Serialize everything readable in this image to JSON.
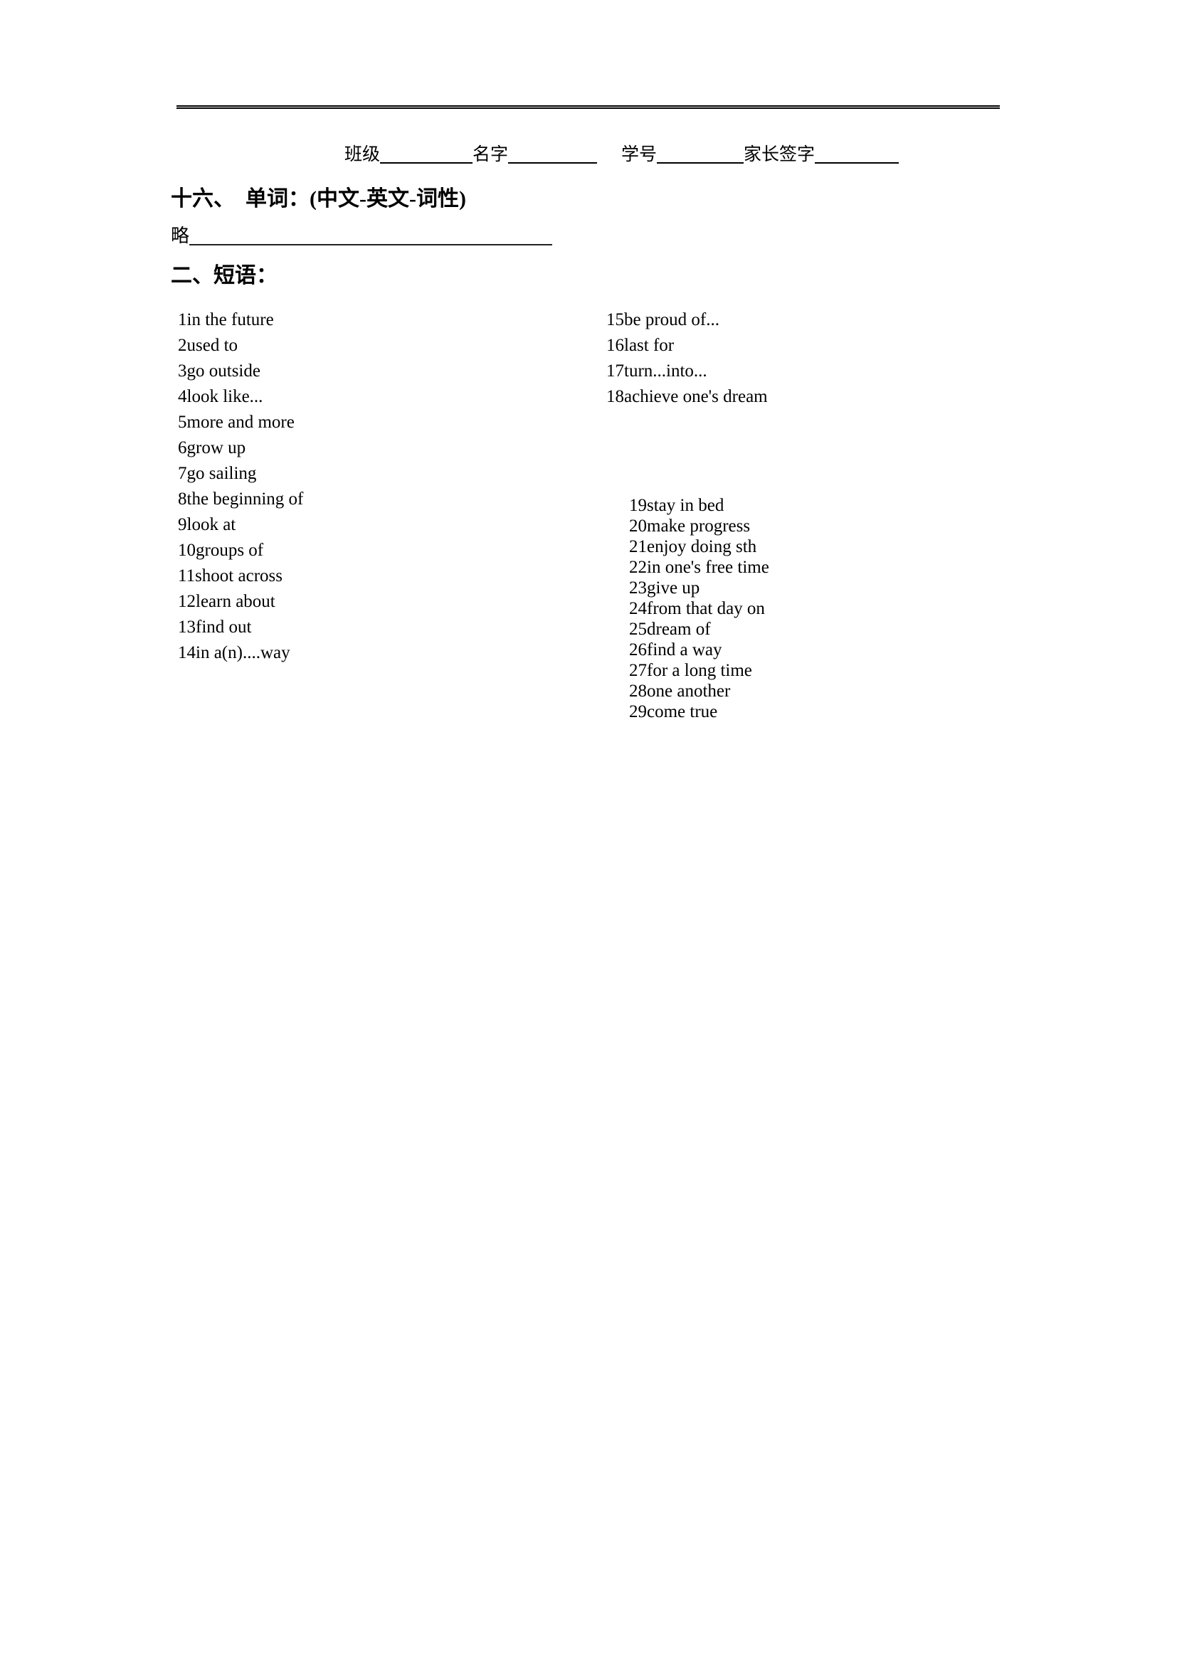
{
  "header": {
    "class_label": "班级",
    "name_label": "名字",
    "student_id_label": "学号",
    "parent_signature_label": "家长签字"
  },
  "sections": [
    {
      "number": "十六、",
      "title_cn": "单词：",
      "title_note": "(中文-英文-词性)"
    },
    {
      "number": "二、",
      "title_cn": "短语："
    }
  ],
  "omitted": {
    "text": "略"
  },
  "headings": {
    "words": "十六、　单词：",
    "words_note": "(中文-英文-词性)",
    "phrases": "二、短语："
  },
  "phrases": {
    "left_column": [
      {
        "num": "1",
        "text": "in the future"
      },
      {
        "num": "2",
        "text": "used to"
      },
      {
        "num": "3",
        "text": "go outside"
      },
      {
        "num": "4",
        "text": "look like..."
      },
      {
        "num": "5",
        "text": "more and more"
      },
      {
        "num": "6",
        "text": "grow up"
      },
      {
        "num": "7",
        "text": "go sailing"
      },
      {
        "num": "8",
        "text": "the beginning of"
      },
      {
        "num": "9",
        "text": "look at"
      },
      {
        "num": "10",
        "text": "groups of"
      },
      {
        "num": "11",
        "text": "shoot across"
      },
      {
        "num": "12",
        "text": "learn about"
      },
      {
        "num": "13",
        "text": "find out"
      },
      {
        "num": "14",
        "text": "in a(n)....way"
      }
    ],
    "right_column_top": [
      {
        "num": "15",
        "text": "be proud of..."
      },
      {
        "num": "16",
        "text": "last for"
      },
      {
        "num": "17",
        "text": "turn...into..."
      },
      {
        "num": "18",
        "text": "achieve one's dream"
      }
    ],
    "right_column_bottom": [
      {
        "num": "19",
        "text": "stay in bed"
      },
      {
        "num": "20",
        "text": "make progress"
      },
      {
        "num": "21",
        "text": "enjoy doing sth"
      },
      {
        "num": "22",
        "text": "in one's free time"
      },
      {
        "num": "23",
        "text": "give up"
      },
      {
        "num": "24",
        "text": "from that day on"
      },
      {
        "num": "25",
        "text": "dream of"
      },
      {
        "num": "26",
        "text": "find a way"
      },
      {
        "num": "27",
        "text": "for a long time"
      },
      {
        "num": "28",
        "text": "one another"
      },
      {
        "num": "29",
        "text": "come true"
      }
    ]
  },
  "colors": {
    "text": "#000000",
    "rule": "#000000",
    "page_background": "#ffffff"
  }
}
